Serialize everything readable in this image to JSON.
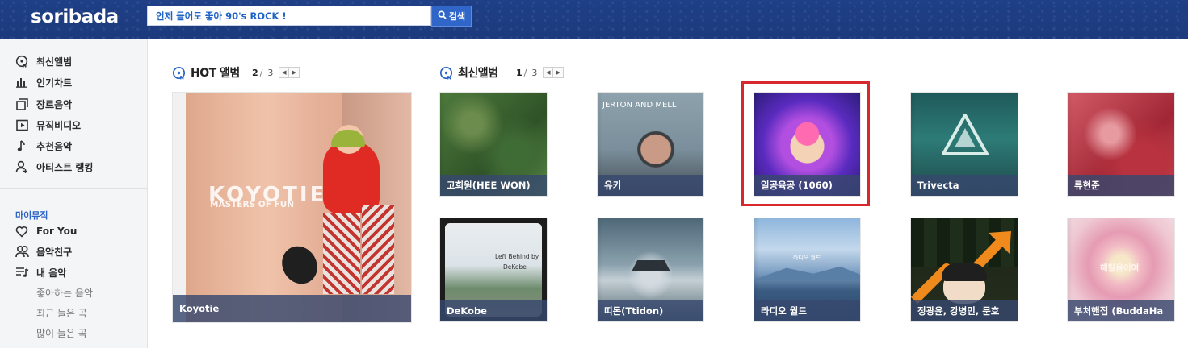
{
  "header": {
    "logo": "soribada",
    "search_placeholder": "언제 들어도 좋아 90's ROCK !",
    "search_button": "검색"
  },
  "sidebar": {
    "items": [
      {
        "label": "최신앨범",
        "icon": "new-album-icon"
      },
      {
        "label": "인기차트",
        "icon": "chart-bars-icon"
      },
      {
        "label": "장르음악",
        "icon": "genre-squares-icon"
      },
      {
        "label": "뮤직비디오",
        "icon": "play-video-icon"
      },
      {
        "label": "추천음악",
        "icon": "music-note-icon"
      },
      {
        "label": "아티스트 랭킹",
        "icon": "artist-person-icon"
      }
    ],
    "my_music_label": "마이뮤직",
    "my_items": [
      {
        "label": "For You",
        "icon": "heart-icon"
      },
      {
        "label": "음악친구",
        "icon": "friends-icon"
      },
      {
        "label": "내 음악",
        "icon": "playlist-icon"
      }
    ],
    "sub_items": [
      "좋아하는 음악",
      "최근 들은 곡",
      "많이 들은 곡"
    ]
  },
  "hot_album": {
    "title": "HOT 앨범",
    "page_current": "2",
    "page_total": "3",
    "albums": [
      {
        "caption": "Koyotie",
        "art_title": "KOYOTIE",
        "art_subtitle": "MASTERS OF FUN"
      }
    ]
  },
  "new_album": {
    "title": "최신앨범",
    "page_current": "1",
    "page_total": "3",
    "albums": [
      {
        "caption": "고희원(HEE WON)"
      },
      {
        "caption": "유키",
        "art_text": "JERTON AND MELL"
      },
      {
        "caption": "일공육공 (1060)"
      },
      {
        "caption": "Trivecta"
      },
      {
        "caption": "류현준"
      },
      {
        "caption": "DeKobe",
        "art_text_1": "Left Behind by",
        "art_text_2": "DeKobe"
      },
      {
        "caption": "띠돈(Ttidon)"
      },
      {
        "caption": "라디오 월드",
        "art_text": "라디오 월드"
      },
      {
        "caption": "정광윤, 강병민, 문호"
      },
      {
        "caption": "부처핸접 (BuddaHa",
        "art_text": "해탈음이여"
      }
    ]
  },
  "pager_prev": "◀",
  "pager_next": "▶"
}
